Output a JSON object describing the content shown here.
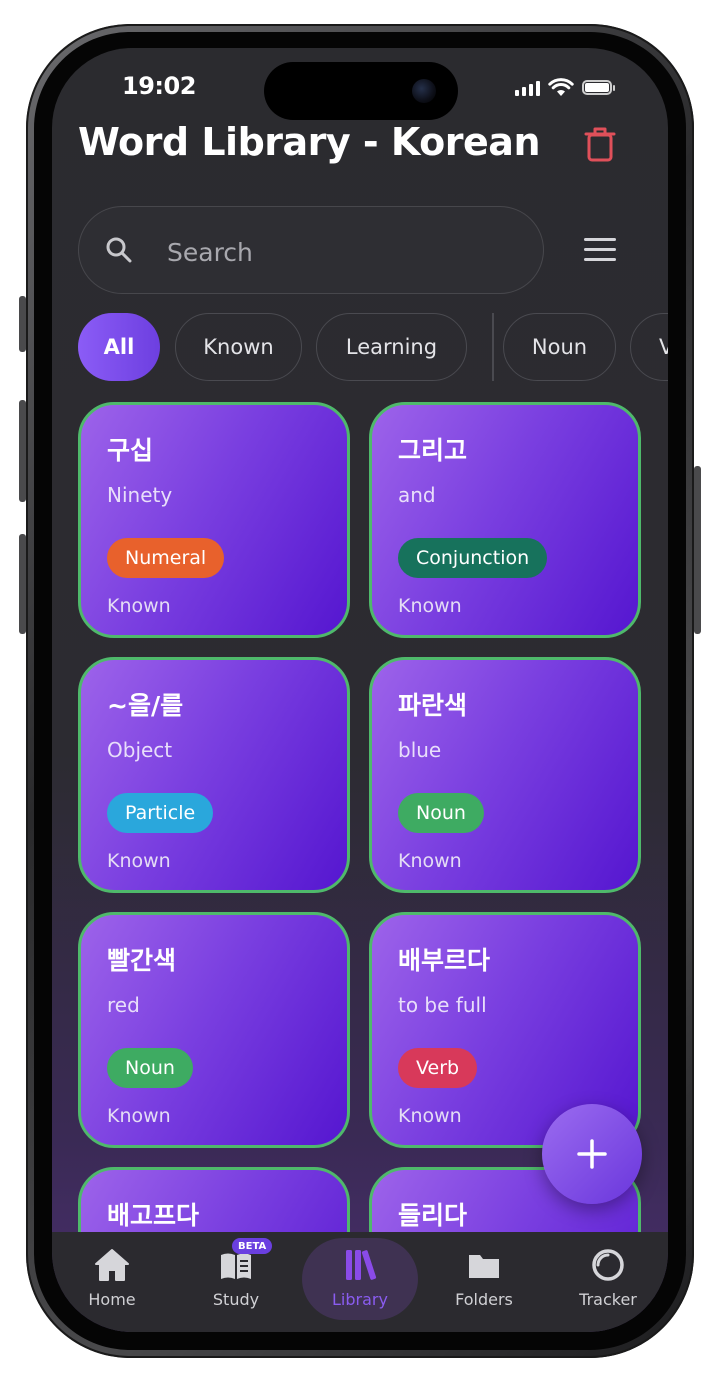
{
  "status_bar": {
    "time": "19:02"
  },
  "header": {
    "title": "Word Library - Korean",
    "delete_icon": "trash-icon"
  },
  "search": {
    "placeholder": "Search",
    "value": "",
    "menu_icon": "hamburger-menu-icon"
  },
  "filters": {
    "chips": [
      {
        "label": "All",
        "active": true
      },
      {
        "label": "Known",
        "active": false
      },
      {
        "label": "Learning",
        "active": false
      },
      {
        "label": "Noun",
        "active": false
      },
      {
        "label": "V",
        "active": false
      }
    ]
  },
  "words": [
    {
      "word": "구십",
      "meaning": "Ninety",
      "tag": "Numeral",
      "tag_color": "#e8612c",
      "status": "Known"
    },
    {
      "word": "그리고",
      "meaning": "and",
      "tag": "Conjunction",
      "tag_color": "#17725c",
      "status": "Known"
    },
    {
      "word": "~을/를",
      "meaning": "Object",
      "tag": "Particle",
      "tag_color": "#2aa7dc",
      "status": "Known"
    },
    {
      "word": "파란색",
      "meaning": "blue",
      "tag": "Noun",
      "tag_color": "#3eab62",
      "status": "Known"
    },
    {
      "word": "빨간색",
      "meaning": "red",
      "tag": "Noun",
      "tag_color": "#3eab62",
      "status": "Known"
    },
    {
      "word": "배부르다",
      "meaning": "to be full",
      "tag": "Verb",
      "tag_color": "#d8395a",
      "status": "Known"
    },
    {
      "word": "배고프다",
      "meaning": "",
      "tag": "",
      "tag_color": "#3eab62",
      "status": ""
    },
    {
      "word": "들리다",
      "meaning": "",
      "tag": "",
      "tag_color": "#3eab62",
      "status": ""
    }
  ],
  "fab": {
    "icon": "plus-icon"
  },
  "nav": {
    "items": [
      {
        "label": "Home",
        "icon": "home-icon"
      },
      {
        "label": "Study",
        "icon": "book-icon",
        "badge": "BETA"
      },
      {
        "label": "Library",
        "icon": "library-icon",
        "active": true
      },
      {
        "label": "Folders",
        "icon": "folder-icon"
      },
      {
        "label": "Tracker",
        "icon": "tracker-icon"
      }
    ]
  },
  "colors": {
    "accent": "#8b5cf6",
    "card_border": "#4fb96b",
    "delete": "#e0505a"
  }
}
